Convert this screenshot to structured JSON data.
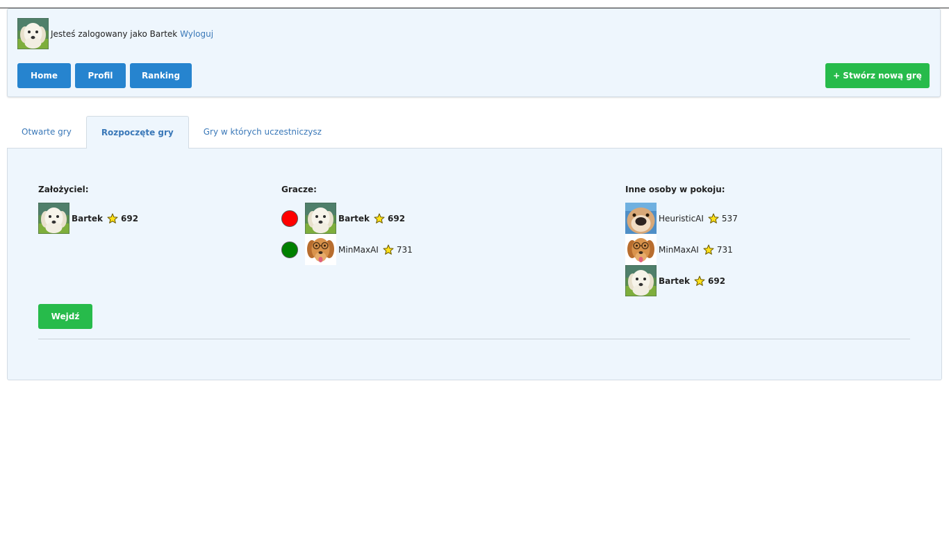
{
  "colors": {
    "primary": "#2684cf",
    "success": "#27bb4b",
    "panel_bg": "#eef6fd",
    "link": "#3a78b8",
    "player_red": "#ff0000",
    "player_green": "#008000"
  },
  "header": {
    "logged_in_text": "Jesteś zalogowany jako Bartek",
    "logout_label": "Wyloguj",
    "nav": {
      "home": "Home",
      "profile": "Profil",
      "ranking": "Ranking"
    },
    "create_game_label": "+ Stwórz nową grę"
  },
  "tabs": {
    "open": "Otwarte gry",
    "started": "Rozpoczęte gry",
    "participating": "Gry w których uczestniczysz",
    "active": "started"
  },
  "game": {
    "founder": {
      "title": "Założyciel:",
      "name": "Bartek",
      "score": "692",
      "avatar": "white-puppy-avatar"
    },
    "players": {
      "title": "Gracze:",
      "list": [
        {
          "color": "red",
          "name": "Bartek",
          "score": "692",
          "avatar": "white-puppy-avatar"
        },
        {
          "color": "green",
          "name": "MinMaxAI",
          "score": "731",
          "avatar": "glasses-dog-avatar"
        }
      ]
    },
    "others": {
      "title": "Inne osoby w pokoju:",
      "list": [
        {
          "name": "HeuristicAI",
          "score": "537",
          "avatar": "nose-dog-avatar"
        },
        {
          "name": "MinMaxAI",
          "score": "731",
          "avatar": "glasses-dog-avatar"
        },
        {
          "name": "Bartek",
          "score": "692",
          "avatar": "white-puppy-avatar"
        }
      ]
    },
    "enter_label": "Wejdź"
  },
  "icons": {
    "star": "star-icon"
  }
}
